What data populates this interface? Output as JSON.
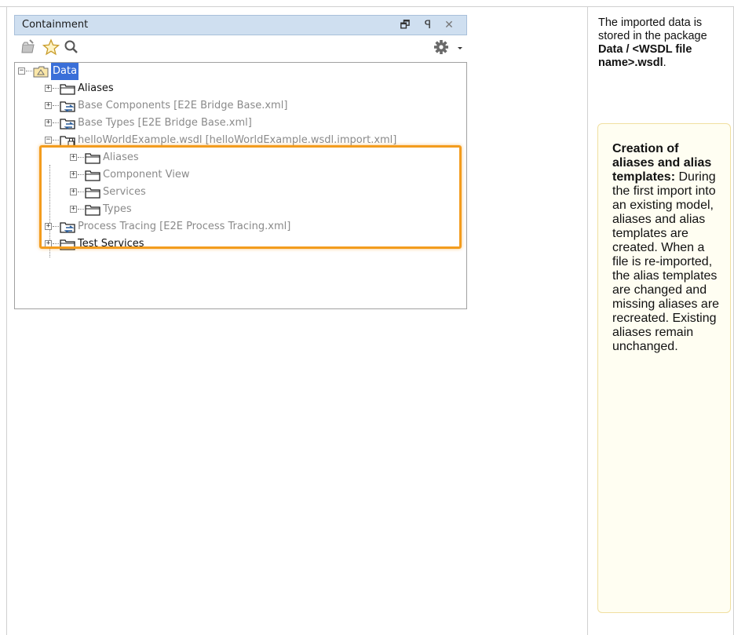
{
  "panel": {
    "title": "Containment",
    "titlebar_buttons": {
      "restore": "🗗",
      "pin": "ꟼ",
      "close": "✕"
    },
    "toolbar": {
      "icons": [
        "new-element-icon",
        "favorite-star-icon",
        "search-icon",
        "settings-gear-icon",
        "dropdown-arrow-icon"
      ]
    },
    "tree": [
      {
        "label": "Data",
        "selected": true
      },
      {
        "label": "Aliases"
      },
      {
        "label": "Base Components [E2E Bridge Base.xml]"
      },
      {
        "label": "Base Types [E2E Bridge Base.xml]"
      },
      {
        "label": "helloWorldExample.wsdl [helloWorldExample.wsdl.import.xml]"
      },
      {
        "label": "Aliases"
      },
      {
        "label": "Component View"
      },
      {
        "label": "Services"
      },
      {
        "label": "Types"
      },
      {
        "label": "Process Tracing [E2E Process Tracing.xml]"
      },
      {
        "label": "Test Services"
      }
    ]
  },
  "note": {
    "text_before": "The imported data is stored in the package ",
    "bold": "Data / <WSDL file name>.wsdl",
    "text_after": "."
  },
  "info": {
    "heading": "Creation of aliases and alias templates:",
    "body": "During the first import into an existing model, aliases and alias templates are created. When a file is re-imported, the alias templates are changed and missing aliases are recreated. Existing aliases remain unchanged."
  },
  "colors": {
    "highlight": "#f39c1e",
    "selection": "#3a6fd8",
    "info_background": "#fffef2"
  }
}
